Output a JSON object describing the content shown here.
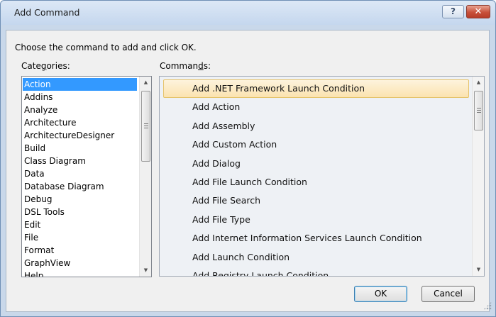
{
  "window": {
    "title": "Add Command",
    "help_label": "?",
    "close_label": "✕"
  },
  "prompt": "Choose the command to add and click OK.",
  "categories": {
    "label_pre": "Cate",
    "label_ul": "g",
    "label_post": "ories:",
    "items": [
      "Action",
      "Addins",
      "Analyze",
      "Architecture",
      "ArchitectureDesigner",
      "Build",
      "Class Diagram",
      "Data",
      "Database Diagram",
      "Debug",
      "DSL Tools",
      "Edit",
      "File",
      "Format",
      "GraphView",
      "Help"
    ],
    "selected": "Action"
  },
  "commands": {
    "label_pre": "Comman",
    "label_ul": "d",
    "label_post": "s:",
    "items": [
      "Add .NET Framework Launch Condition",
      "Add Action",
      "Add Assembly",
      "Add Custom Action",
      "Add Dialog",
      "Add File Launch Condition",
      "Add File Search",
      "Add File Type",
      "Add Internet Information Services Launch Condition",
      "Add Launch Condition",
      "Add Registry Launch Condition"
    ],
    "selected": "Add .NET Framework Launch Condition"
  },
  "buttons": {
    "ok": "OK",
    "cancel": "Cancel"
  }
}
